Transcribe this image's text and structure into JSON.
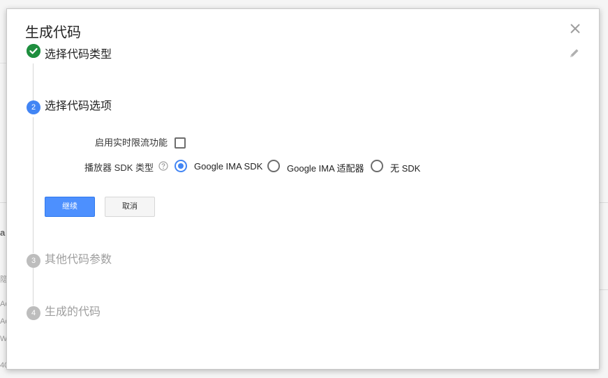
{
  "dialog": {
    "title": "生成代码"
  },
  "steps": [
    {
      "number": "",
      "title": "选择代码类型",
      "state": "done"
    },
    {
      "number": "2",
      "title": "选择代码选项",
      "state": "active"
    },
    {
      "number": "3",
      "title": "其他代码参数",
      "state": "pending"
    },
    {
      "number": "4",
      "title": "生成的代码",
      "state": "pending"
    }
  ],
  "options": {
    "realtime_throttle_label": "启用实时限流功能",
    "realtime_throttle_checked": false,
    "player_sdk_label": "播放器 SDK 类型",
    "player_sdk_choices": [
      "Google IMA SDK",
      "Google IMA 适配器",
      "无 SDK"
    ],
    "player_sdk_selected": "Google IMA SDK"
  },
  "buttons": {
    "continue_label": "继续",
    "cancel_label": "取消"
  },
  "colors": {
    "accent": "#4285f4",
    "done": "#0f9d58",
    "pending": "#bdbdbd",
    "primary_button": "#4d90fe"
  },
  "icons": {
    "close": "close-icon",
    "edit": "pencil-icon",
    "done": "checkmark-circle-icon",
    "help": "help-circle-icon"
  },
  "background": {
    "fragments": [
      "a",
      "隐",
      "Ac",
      "Ac",
      "W",
      "40"
    ]
  }
}
